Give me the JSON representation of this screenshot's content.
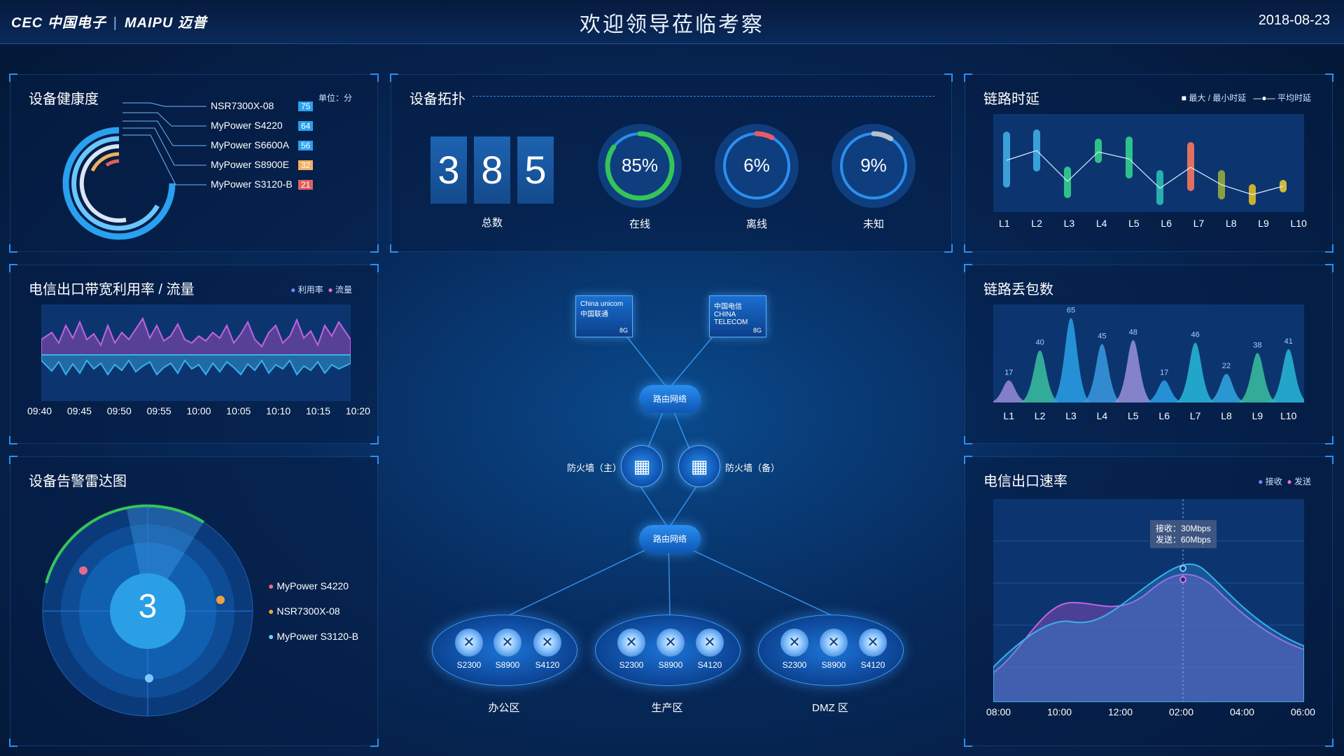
{
  "header": {
    "logo_left": "CEC 中国电子",
    "logo_right": "MAIPU 迈普",
    "title": "欢迎领导莅临考察",
    "date": "2018-08-23"
  },
  "colors": {
    "accent": "#2a8ff0",
    "bg": "#072a5c",
    "green": "#35c45a",
    "red": "#e85a6a",
    "gray": "#b8c0cc"
  },
  "health": {
    "title": "设备健康度",
    "unit": "单位：分",
    "items": [
      {
        "name": "NSR7300X-08",
        "score": "75",
        "color": "#2aa0f0"
      },
      {
        "name": "MyPower S4220",
        "score": "64",
        "color": "#6ac6ff"
      },
      {
        "name": "MyPower S6600A",
        "score": "56",
        "color": "#d8e6f5"
      },
      {
        "name": "MyPower S8900E",
        "score": "32",
        "color": "#f0b060"
      },
      {
        "name": "MyPower S3120-B",
        "score": "21",
        "color": "#e06060"
      }
    ]
  },
  "bandwidth": {
    "title": "电信出口带宽利用率 / 流量",
    "legend": [
      "利用率",
      "流量"
    ],
    "times": [
      "09:40",
      "09:45",
      "09:50",
      "09:55",
      "10:00",
      "10:05",
      "10:10",
      "10:15",
      "10:20"
    ]
  },
  "alarm": {
    "title": "设备告警雷达图",
    "count": "3",
    "items": [
      {
        "name": "MyPower S4220",
        "color": "#e86a88"
      },
      {
        "name": "NSR7300X-08",
        "color": "#f0a040"
      },
      {
        "name": "MyPower S3120-B",
        "color": "#7ec8ff"
      }
    ]
  },
  "topology": {
    "title": "设备拓扑",
    "digits": [
      "3",
      "8",
      "5"
    ],
    "total_label": "总数",
    "rings": [
      {
        "value": "85%",
        "label": "在线",
        "fraction": 0.85,
        "color": "#35c45a"
      },
      {
        "value": "6%",
        "label": "离线",
        "fraction": 0.06,
        "color": "#e85a6a"
      },
      {
        "value": "9%",
        "label": "未知",
        "fraction": 0.09,
        "color": "#b8c0cc"
      }
    ],
    "isp1_text": "China unicom中国联通",
    "isp2_text": "中国电信 CHINA TELECOM",
    "isp_badge": "8G",
    "router": "路由网络",
    "fw_main": "防火墙（主）",
    "fw_backup": "防火墙（备）",
    "switches": [
      "S2300",
      "S8900",
      "S4120"
    ],
    "zones": [
      "办公区",
      "生产区",
      "DMZ 区"
    ]
  },
  "latency": {
    "title": "链路时延",
    "legend": [
      "最大 / 最小时延",
      "平均时延"
    ],
    "links": [
      "L1",
      "L2",
      "L3",
      "L4",
      "L5",
      "L6",
      "L7",
      "L8",
      "L9",
      "L10"
    ]
  },
  "loss": {
    "title": "链路丢包数",
    "chart_data": {
      "type": "area",
      "categories": [
        "L1",
        "L2",
        "L3",
        "L4",
        "L5",
        "L6",
        "L7",
        "L8",
        "L9",
        "L10"
      ],
      "values": [
        17,
        40,
        65,
        45,
        48,
        17,
        46,
        22,
        38,
        41
      ]
    }
  },
  "rate": {
    "title": "电信出口速率",
    "legend": [
      "接收",
      "发送"
    ],
    "tooltip": [
      "接收：30Mbps",
      "发送：60Mbps"
    ],
    "times": [
      "08:00",
      "10:00",
      "12:00",
      "02:00",
      "04:00",
      "06:00"
    ]
  }
}
